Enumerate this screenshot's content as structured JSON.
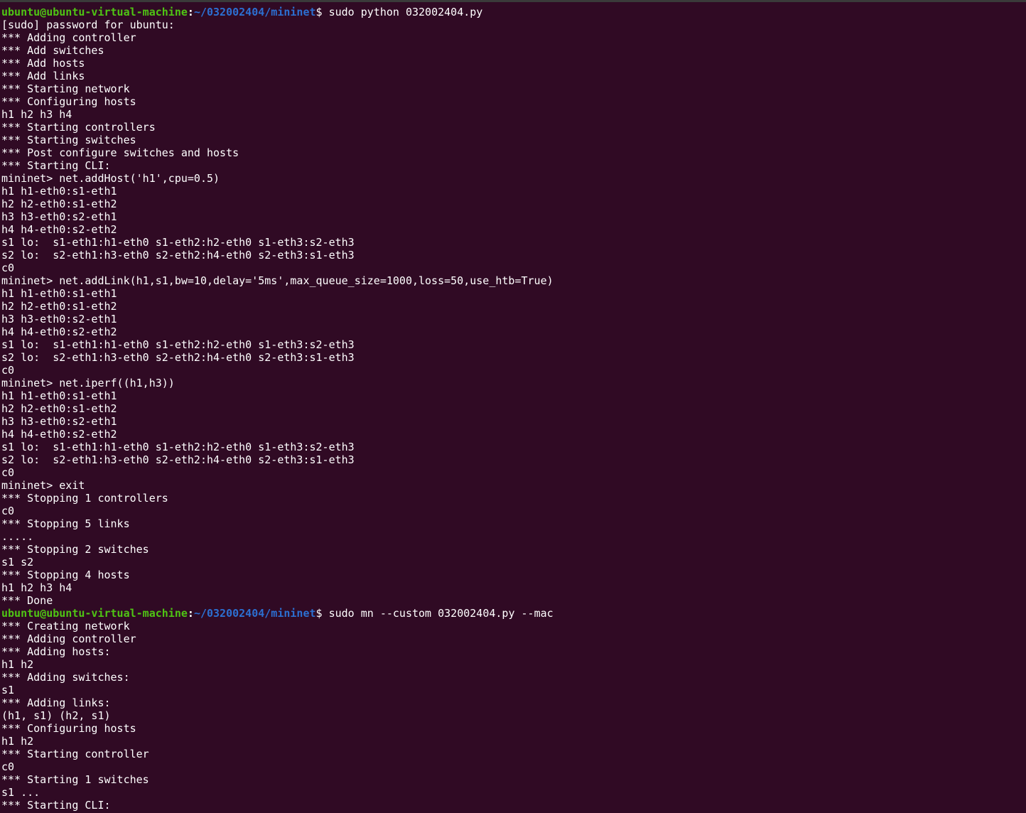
{
  "colors": {
    "background": "#300a24",
    "foreground": "#ffffff",
    "prompt_user": "#4fc414",
    "prompt_path": "#2c6fd1"
  },
  "prompt": {
    "user_host": "ubuntu@ubuntu-virtual-machine",
    "colon": ":",
    "path": "~/032002404/mininet",
    "dollar": "$ "
  },
  "lines": [
    {
      "type": "prompt",
      "cmd": "sudo python 032002404.py"
    },
    {
      "type": "text",
      "text": "[sudo] password for ubuntu:"
    },
    {
      "type": "text",
      "text": "*** Adding controller"
    },
    {
      "type": "text",
      "text": "*** Add switches"
    },
    {
      "type": "text",
      "text": "*** Add hosts"
    },
    {
      "type": "text",
      "text": "*** Add links"
    },
    {
      "type": "text",
      "text": "*** Starting network"
    },
    {
      "type": "text",
      "text": "*** Configuring hosts"
    },
    {
      "type": "text",
      "text": "h1 h2 h3 h4"
    },
    {
      "type": "text",
      "text": "*** Starting controllers"
    },
    {
      "type": "text",
      "text": "*** Starting switches"
    },
    {
      "type": "text",
      "text": "*** Post configure switches and hosts"
    },
    {
      "type": "text",
      "text": "*** Starting CLI:"
    },
    {
      "type": "text",
      "text": "mininet> net.addHost('h1',cpu=0.5)"
    },
    {
      "type": "text",
      "text": "h1 h1-eth0:s1-eth1"
    },
    {
      "type": "text",
      "text": "h2 h2-eth0:s1-eth2"
    },
    {
      "type": "text",
      "text": "h3 h3-eth0:s2-eth1"
    },
    {
      "type": "text",
      "text": "h4 h4-eth0:s2-eth2"
    },
    {
      "type": "text",
      "text": "s1 lo:  s1-eth1:h1-eth0 s1-eth2:h2-eth0 s1-eth3:s2-eth3"
    },
    {
      "type": "text",
      "text": "s2 lo:  s2-eth1:h3-eth0 s2-eth2:h4-eth0 s2-eth3:s1-eth3"
    },
    {
      "type": "text",
      "text": "c0"
    },
    {
      "type": "text",
      "text": "mininet> net.addLink(h1,s1,bw=10,delay='5ms',max_queue_size=1000,loss=50,use_htb=True)"
    },
    {
      "type": "text",
      "text": "h1 h1-eth0:s1-eth1"
    },
    {
      "type": "text",
      "text": "h2 h2-eth0:s1-eth2"
    },
    {
      "type": "text",
      "text": "h3 h3-eth0:s2-eth1"
    },
    {
      "type": "text",
      "text": "h4 h4-eth0:s2-eth2"
    },
    {
      "type": "text",
      "text": "s1 lo:  s1-eth1:h1-eth0 s1-eth2:h2-eth0 s1-eth3:s2-eth3"
    },
    {
      "type": "text",
      "text": "s2 lo:  s2-eth1:h3-eth0 s2-eth2:h4-eth0 s2-eth3:s1-eth3"
    },
    {
      "type": "text",
      "text": "c0"
    },
    {
      "type": "text",
      "text": "mininet> net.iperf((h1,h3))"
    },
    {
      "type": "text",
      "text": "h1 h1-eth0:s1-eth1"
    },
    {
      "type": "text",
      "text": "h2 h2-eth0:s1-eth2"
    },
    {
      "type": "text",
      "text": "h3 h3-eth0:s2-eth1"
    },
    {
      "type": "text",
      "text": "h4 h4-eth0:s2-eth2"
    },
    {
      "type": "text",
      "text": "s1 lo:  s1-eth1:h1-eth0 s1-eth2:h2-eth0 s1-eth3:s2-eth3"
    },
    {
      "type": "text",
      "text": "s2 lo:  s2-eth1:h3-eth0 s2-eth2:h4-eth0 s2-eth3:s1-eth3"
    },
    {
      "type": "text",
      "text": "c0"
    },
    {
      "type": "text",
      "text": "mininet> exit"
    },
    {
      "type": "text",
      "text": "*** Stopping 1 controllers"
    },
    {
      "type": "text",
      "text": "c0"
    },
    {
      "type": "text",
      "text": "*** Stopping 5 links"
    },
    {
      "type": "text",
      "text": "....."
    },
    {
      "type": "text",
      "text": "*** Stopping 2 switches"
    },
    {
      "type": "text",
      "text": "s1 s2"
    },
    {
      "type": "text",
      "text": "*** Stopping 4 hosts"
    },
    {
      "type": "text",
      "text": "h1 h2 h3 h4"
    },
    {
      "type": "text",
      "text": "*** Done"
    },
    {
      "type": "prompt",
      "cmd": "sudo mn --custom 032002404.py --mac"
    },
    {
      "type": "text",
      "text": "*** Creating network"
    },
    {
      "type": "text",
      "text": "*** Adding controller"
    },
    {
      "type": "text",
      "text": "*** Adding hosts:"
    },
    {
      "type": "text",
      "text": "h1 h2"
    },
    {
      "type": "text",
      "text": "*** Adding switches:"
    },
    {
      "type": "text",
      "text": "s1"
    },
    {
      "type": "text",
      "text": "*** Adding links:"
    },
    {
      "type": "text",
      "text": "(h1, s1) (h2, s1)"
    },
    {
      "type": "text",
      "text": "*** Configuring hosts"
    },
    {
      "type": "text",
      "text": "h1 h2"
    },
    {
      "type": "text",
      "text": "*** Starting controller"
    },
    {
      "type": "text",
      "text": "c0"
    },
    {
      "type": "text",
      "text": "*** Starting 1 switches"
    },
    {
      "type": "text",
      "text": "s1 ..."
    },
    {
      "type": "text",
      "text": "*** Starting CLI:"
    }
  ]
}
